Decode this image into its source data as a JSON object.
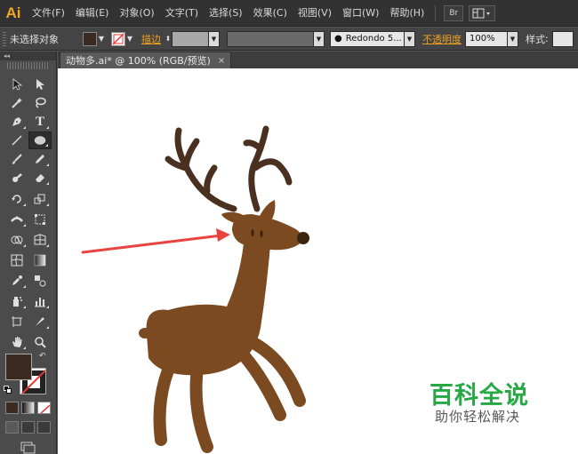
{
  "app": {
    "logo_text": "Ai",
    "logo_color": "#f5a623",
    "accent_orange": "#f0a020"
  },
  "menubar": {
    "items": [
      "文件(F)",
      "编辑(E)",
      "对象(O)",
      "文字(T)",
      "选择(S)",
      "效果(C)",
      "视图(V)",
      "窗口(W)",
      "帮助(H)"
    ],
    "bridge_button": "Br",
    "arrange_icon": "workspace-layout-icon"
  },
  "controlbar": {
    "selection_status": "未选择对象",
    "fill_color": "#3b2a1f",
    "stroke_icon": "no-stroke-icon",
    "stroke_label": "描边",
    "brush_label": "Redondo 5...",
    "opacity_label": "不透明度",
    "opacity_value": "100%",
    "style_label": "样式"
  },
  "document": {
    "tab_title": "动物多.ai* @ 100% (RGB/预览)",
    "close_glyph": "×"
  },
  "tools": {
    "type_tool_glyph": "T",
    "fill_swatch": "#3b2a1f",
    "stroke_swatch": "no-stroke",
    "tool_icons": [
      "selection-arrow-icon",
      "direct-selection-arrow-icon",
      "magic-wand-icon",
      "lasso-icon",
      "pen-tool-icon",
      "type-tool-icon",
      "line-segment-icon",
      "ellipse-tool-icon",
      "paintbrush-icon",
      "pencil-icon",
      "blob-brush-icon",
      "eraser-icon",
      "rotate-icon",
      "scale-icon",
      "width-tool-icon",
      "free-transform-icon",
      "shape-builder-icon",
      "perspective-grid-icon",
      "mesh-icon",
      "gradient-icon",
      "eyedropper-icon",
      "blend-icon",
      "symbol-sprayer-icon",
      "column-graph-icon",
      "artboard-icon",
      "slice-icon",
      "hand-icon",
      "zoom-icon"
    ]
  },
  "canvas": {
    "artwork": "reindeer",
    "colors": {
      "body": "#7b4a21",
      "antler": "#4a3021",
      "eye": "#3a2410",
      "nose": "#3a2410",
      "arrow": "#e8443d"
    }
  },
  "watermark": {
    "title": "百科全说",
    "subtitle": "助你轻松解决",
    "title_color": "#27a844"
  }
}
